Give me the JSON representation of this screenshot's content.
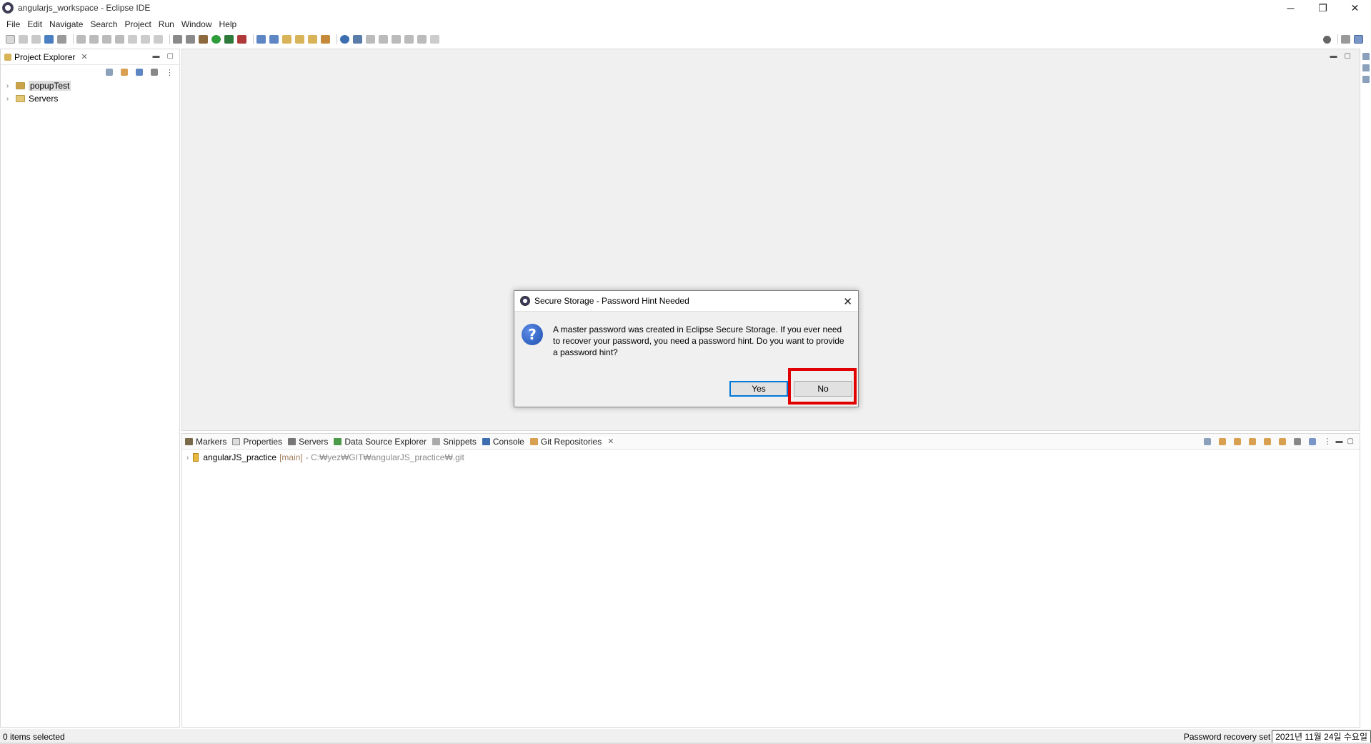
{
  "window": {
    "title": "angularjs_workspace - Eclipse IDE",
    "controls": [
      "─",
      "❐",
      "✕"
    ]
  },
  "menu": [
    "File",
    "Edit",
    "Navigate",
    "Search",
    "Project",
    "Run",
    "Window",
    "Help"
  ],
  "project_explorer": {
    "tab_label": "Project Explorer",
    "items": [
      {
        "label": "popupTest",
        "icon": "project-icon"
      },
      {
        "label": "Servers",
        "icon": "folder-icon"
      }
    ]
  },
  "bottom_panel": {
    "tabs": [
      "Markers",
      "Properties",
      "Servers",
      "Data Source Explorer",
      "Snippets",
      "Console",
      "Git Repositories"
    ],
    "active_tab": "Git Repositories",
    "repo": {
      "name": "angularJS_practice",
      "branch": "[main]",
      "path": "- C:₩yez₩GIT₩angularJS_practice₩.git"
    }
  },
  "dialog": {
    "title": "Secure Storage - Password Hint Needed",
    "message": "A master password was created in Eclipse Secure Storage. If you ever need to recover your password, you need a password hint. Do you want to provide a password hint?",
    "yes_label": "Yes",
    "no_label": "No",
    "icon": "question-icon",
    "highlight_color": "#e00000"
  },
  "status": {
    "selection": "0 items selected",
    "recovery": "Password recovery set",
    "date": "2021년 11월 24일 수요일"
  }
}
